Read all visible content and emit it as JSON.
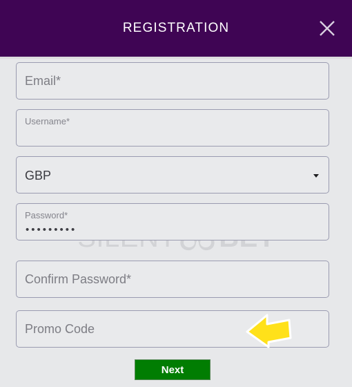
{
  "header": {
    "title": "REGISTRATION",
    "close_icon": "close-icon",
    "background_color": "#3f0554",
    "title_color": "#ffffff"
  },
  "watermark": {
    "text_light": "SILENT",
    "text_bold": "BET",
    "icon": "owl-icon",
    "color": "#d2d3d6"
  },
  "form": {
    "fields": [
      {
        "name": "email",
        "placeholder": "Email*",
        "value": "",
        "type": "text"
      },
      {
        "name": "username",
        "label": "Username*",
        "placeholder": "",
        "value": "",
        "type": "text"
      },
      {
        "name": "currency",
        "value": "GBP",
        "type": "select",
        "caret_icon": "chevron-down-icon"
      },
      {
        "name": "password",
        "label": "Password*",
        "value": "•••••••••",
        "type": "password"
      },
      {
        "name": "confirm_password",
        "placeholder": "Confirm Password*",
        "value": "",
        "type": "password"
      },
      {
        "name": "promo_code",
        "placeholder": "Promo Code",
        "value": "",
        "type": "text"
      }
    ],
    "submit_label": "Next",
    "submit_color": "#017d02"
  },
  "annotation": {
    "icon": "arrow-left-icon",
    "color": "#ffe11a",
    "outline_color": "#ffffff"
  },
  "page": {
    "background_color": "#e7e8ea",
    "field_border_color": "#9a9bb0"
  }
}
